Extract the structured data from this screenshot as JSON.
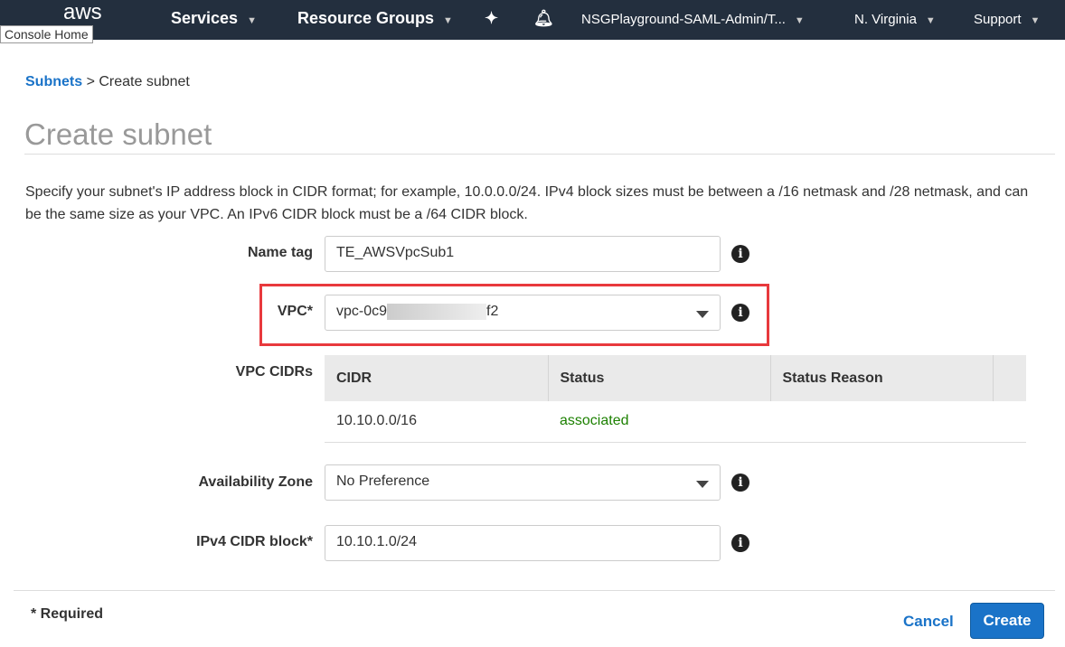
{
  "nav": {
    "logo": "aws",
    "tooltip": "Console Home",
    "services": "Services",
    "resource_groups": "Resource Groups",
    "account": "NSGPlayground-SAML-Admin/T...",
    "region": "N. Virginia",
    "support": "Support"
  },
  "breadcrumb": {
    "parent": "Subnets",
    "separator": " > ",
    "current": "Create subnet"
  },
  "title": "Create subnet",
  "description": "Specify your subnet's IP address block in CIDR format; for example, 10.0.0.0/24. IPv4 block sizes must be between a /16 netmask and /28 netmask, and can be the same size as your VPC. An IPv6 CIDR block must be a /64 CIDR block.",
  "form": {
    "name_tag": {
      "label": "Name tag",
      "value": "TE_AWSVpcSub1"
    },
    "vpc": {
      "label": "VPC*",
      "value_prefix": "vpc-0c9",
      "value_suffix": "f2"
    },
    "vpc_cidrs": {
      "label": "VPC CIDRs",
      "columns": [
        "CIDR",
        "Status",
        "Status Reason"
      ],
      "rows": [
        {
          "cidr": "10.10.0.0/16",
          "status": "associated",
          "reason": ""
        }
      ]
    },
    "az": {
      "label": "Availability Zone",
      "value": "No Preference"
    },
    "ipv4": {
      "label": "IPv4 CIDR block*",
      "value": "10.10.1.0/24"
    }
  },
  "footer": {
    "required": "* Required",
    "cancel": "Cancel",
    "create": "Create"
  },
  "colors": {
    "nav": "#232f3e",
    "link": "#1a73c8",
    "highlight": "#e8393d",
    "associated": "#1d8102"
  }
}
